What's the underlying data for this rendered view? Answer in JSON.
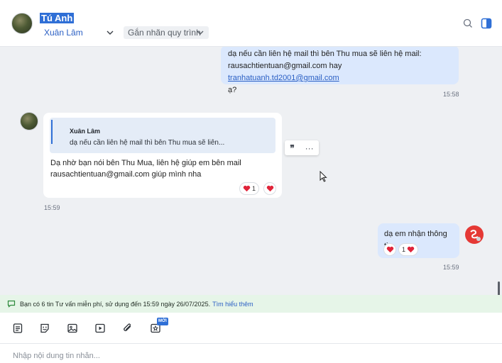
{
  "header": {
    "contact_name": "Tú Anh",
    "assignee": "Xuân Lâm",
    "tag_placeholder": "Gắn nhãn quy trình"
  },
  "messages": {
    "out1": {
      "line1": "dạ nếu cần liên hệ mail thì bên Thu mua sẽ liên hệ mail:",
      "line2_prefix": "rausachtientuan@gmail.com hay ",
      "line2_link": "tranhatuanh.td2001@gmail.com",
      "line3": "ạ?",
      "time": "15:58"
    },
    "in1": {
      "quote_author": "Xuân Lâm",
      "quote_text": "dạ nếu cần liên hệ mail thì bên Thu mua sẽ liên...",
      "line1": "Dạ nhờ bạn nói bên Thu Mua, liên hệ giúp em bên mail",
      "line2": "rausachtientuan@gmail.com giúp mình nha",
      "reaction_count": "1",
      "time": "15:59"
    },
    "out2": {
      "text": "dạ em nhận thông tin",
      "reaction_count": "1",
      "time": "15:59"
    }
  },
  "hover_actions": {
    "quote_glyph": "❞",
    "more_glyph": "···"
  },
  "notice": {
    "text": "Bạn có 6 tin Tư vấn miễn phí, sử dụng đến 15:59 ngày 26/07/2025.",
    "link": "Tìm hiểu thêm"
  },
  "toolbar": {
    "new_badge": "MỚI",
    "icons": [
      "note-icon",
      "sticker-icon",
      "image-icon",
      "video-icon",
      "attachment-icon",
      "star-card-icon"
    ]
  },
  "composer": {
    "placeholder": "Nhập nội dung tin nhắn..."
  },
  "colors": {
    "accent": "#2f6fd6",
    "outgoing_bubble": "#dbe8fd",
    "background": "#eef0f3",
    "notice_bg": "#e6f5e8",
    "heart": "#e0243a"
  }
}
